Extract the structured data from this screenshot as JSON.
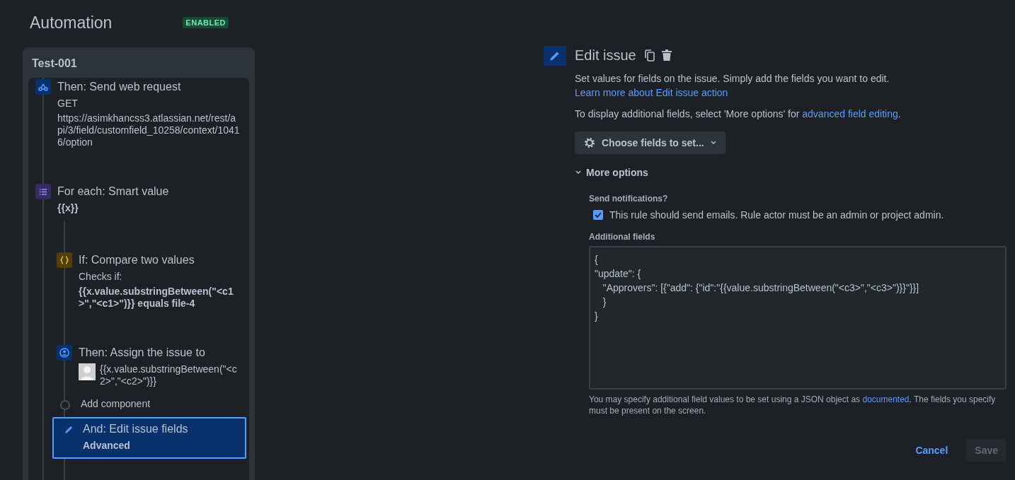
{
  "header": {
    "title": "Automation",
    "status": "ENABLED"
  },
  "rule": {
    "name": "Test-001",
    "steps": [
      {
        "kind": "request",
        "title": "Then: Send web request",
        "details": [
          {
            "text": "GET",
            "bold": false
          },
          {
            "text": "https://asimkhancss3.atlassian.net/rest/api/3/field/customfield_10258/context/10416/option",
            "bold": false
          }
        ]
      },
      {
        "kind": "loop",
        "title": "For each: Smart value",
        "details": [
          {
            "text": "{{x}}",
            "bold": true
          }
        ],
        "children": [
          {
            "kind": "condition",
            "title": "If: Compare two values",
            "details": [
              {
                "text": "Checks if:",
                "bold": false
              },
              {
                "text": "{{x.value.substringBetween(\"<c1>\",\"<c1>\")}} equals file-4",
                "bold": true
              }
            ],
            "selected": false
          },
          {
            "kind": "assign",
            "title": "Then: Assign the issue to",
            "details": [
              {
                "text": "{{x.value.substringBetween(\"<c2>\",\"<c2>\")}}",
                "bold": false
              }
            ],
            "selected": false
          },
          {
            "kind": "add",
            "title": "Add component",
            "selected": false
          },
          {
            "kind": "edit",
            "title": "And: Edit issue fields",
            "details": [
              {
                "text": "Advanced",
                "bold": true
              }
            ],
            "selected": true
          }
        ]
      }
    ]
  },
  "editor": {
    "title": "Edit issue",
    "description": {
      "text": "Set values for fields on the issue. Simply add the fields you want to edit. ",
      "link": "Learn more about Edit issue action"
    },
    "hint": {
      "text": "To display additional fields, select 'More options' for ",
      "link": "advanced field editing",
      "after": "."
    },
    "choose_button": "Choose fields to set...",
    "more_options": {
      "label": "More options",
      "expanded": true
    },
    "notifications": {
      "label": "Send notifications?",
      "checkbox_label": "This rule should send emails. Rule actor must be an admin or project admin.",
      "checked": true
    },
    "additional_fields": {
      "label": "Additional fields",
      "value": "{\n\"update\": {\n   \"Approvers\": [{\"add\": {\"id\":\"{{value.substringBetween(\"<c3>\",\"<c3>\")}}\"}}]\n   }\n}"
    },
    "help": {
      "text": "You may specify additional field values to be set using a JSON object as ",
      "link": "documented",
      "after": ". The fields you specify must be present on the screen."
    },
    "buttons": [
      {
        "label": "Cancel",
        "kind": "link",
        "disabled": false
      },
      {
        "label": "Save",
        "kind": "primary",
        "disabled": true
      }
    ]
  }
}
